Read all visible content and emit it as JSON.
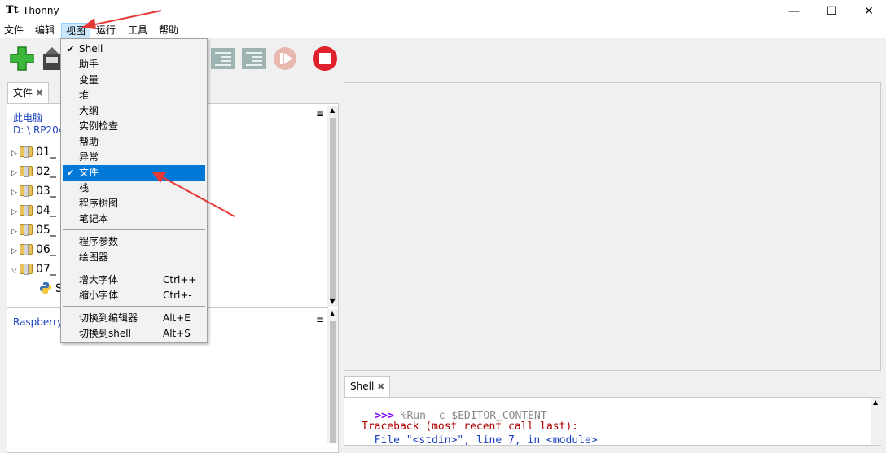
{
  "window": {
    "title": "Thonny",
    "icon": "Tt",
    "controls": {
      "minimize": "—",
      "maximize": "☐",
      "close": "✕"
    }
  },
  "menubar": [
    "文件",
    "编辑",
    "视图",
    "运行",
    "工具",
    "帮助"
  ],
  "files_panel": {
    "tab_label": "文件",
    "close_glyph": "✖",
    "location_line1": "此电脑",
    "location_line2": "D: \\ RP204",
    "menu_glyph": "≡",
    "folders": [
      "01_",
      "02_",
      "03_",
      "04_",
      "05_",
      "06_",
      "07_"
    ],
    "file_item": "S",
    "lower_title": "Raspberry"
  },
  "view_menu": {
    "items": [
      {
        "label": "Shell",
        "checked": true
      },
      {
        "label": "助手"
      },
      {
        "label": "变量"
      },
      {
        "label": "堆"
      },
      {
        "label": "大纲"
      },
      {
        "label": "实例检查"
      },
      {
        "label": "帮助"
      },
      {
        "label": "异常"
      },
      {
        "label": "文件",
        "checked": true,
        "highlighted": true
      },
      {
        "label": "栈"
      },
      {
        "label": "程序树图"
      },
      {
        "label": "笔记本"
      }
    ],
    "group2": [
      {
        "label": "程序参数"
      },
      {
        "label": "绘图器"
      }
    ],
    "group3": [
      {
        "label": "增大字体",
        "accel": "Ctrl++"
      },
      {
        "label": "缩小字体",
        "accel": "Ctrl+-"
      }
    ],
    "group4": [
      {
        "label": "切换到编辑器",
        "accel": "Alt+E"
      },
      {
        "label": "切换到shell",
        "accel": "Alt+S"
      }
    ],
    "check_glyph": "✔"
  },
  "shell": {
    "tab_label": "Shell",
    "close_glyph": "✖",
    "prompt": ">>>",
    "command": " %Run -c $EDITOR_CONTENT",
    "traceback": "Traceback (most recent call last):",
    "file_line": "  File \"<stdin>\", line 7, in <module>"
  },
  "colors": {
    "accent": "#0078d7",
    "arrow": "#e53935",
    "error": "#b00000",
    "prompt": "#7f00ff",
    "link": "#1a3fbf"
  }
}
